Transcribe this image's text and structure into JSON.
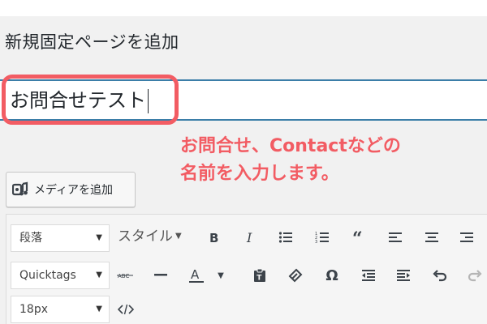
{
  "page": {
    "title": "新規固定ページを追加"
  },
  "title_field": {
    "value": "お問合せテスト"
  },
  "annotation": {
    "line1": "お問合せ、Contactなどの",
    "line2": "名前を入力します。",
    "color": "#f25c63"
  },
  "media_button": {
    "label": "メディアを追加"
  },
  "toolbar": {
    "format_select": {
      "value": "段落"
    },
    "style_menu": {
      "label": "スタイル"
    },
    "quicktags_select": {
      "value": "Quicktags"
    },
    "font_size_select": {
      "value": "18px"
    },
    "buttons_row1": [
      "bold-icon",
      "italic-icon",
      "bullet-list-icon",
      "numbered-list-icon",
      "blockquote-icon",
      "align-left-icon",
      "align-center-icon",
      "align-right-icon"
    ],
    "buttons_row2": [
      "strikethrough-icon",
      "horizontal-line-icon",
      "text-color-icon",
      "paste-as-text-icon",
      "clear-formatting-icon",
      "special-character-icon",
      "outdent-icon",
      "indent-icon",
      "undo-icon",
      "redo-icon"
    ],
    "buttons_row3": [
      "code-icon"
    ]
  },
  "colors": {
    "accent_border": "#3b7ea8",
    "highlight": "#f25c63"
  }
}
